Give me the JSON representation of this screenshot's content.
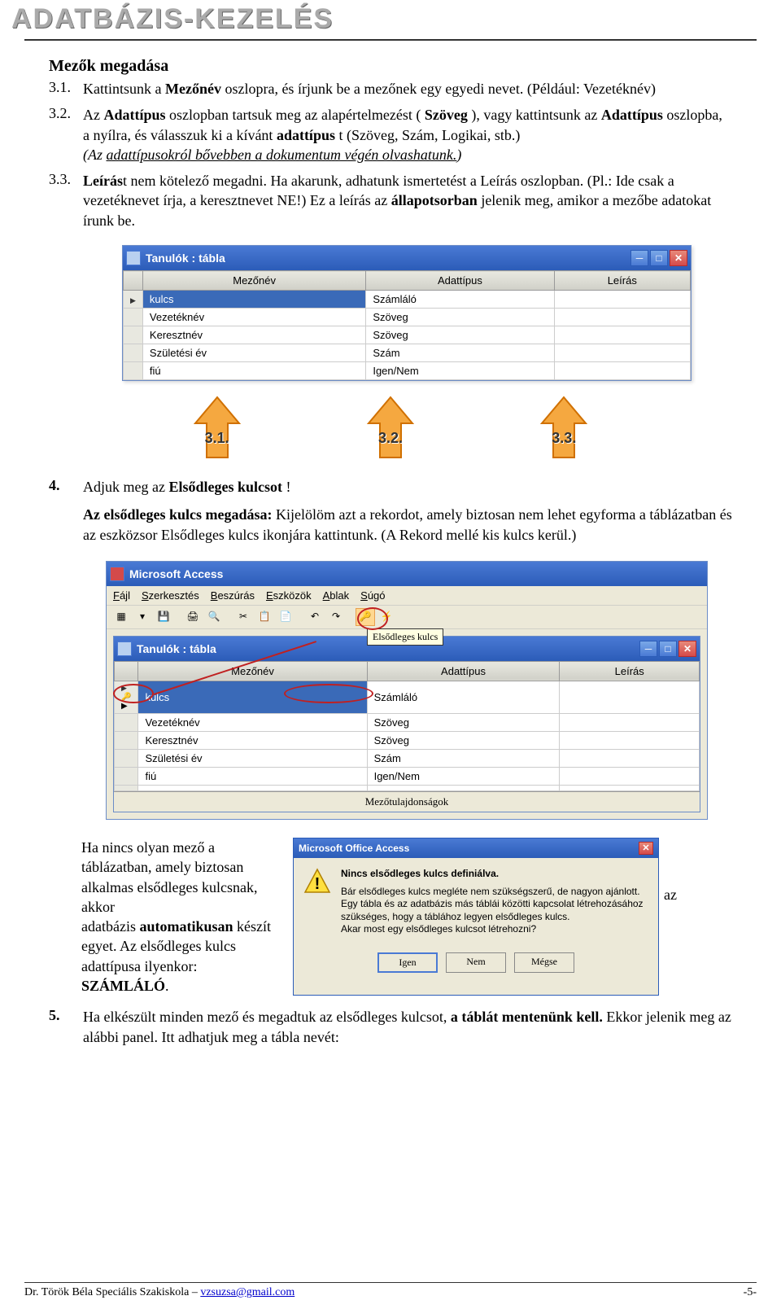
{
  "header": {
    "title": "ADATBÁZIS-KEZELÉS"
  },
  "section_title": "Mezők megadása",
  "items": {
    "i31": {
      "num": "3.1.",
      "text_pre": "Kattintsunk a ",
      "bold1": "Mezőnév",
      "text_mid": " oszlopra, és írjunk be a mezőnek egy egyedi nevet. (Például: Vezetéknév)"
    },
    "i32": {
      "num": "3.2.",
      "text_pre": "Az ",
      "bold1": "Adattípus",
      "text_mid": " oszlopban tartsuk meg az alapértelmezést (",
      "bold2": "Szöveg",
      "text_mid2": "), vagy kattintsunk az ",
      "bold3": "Adattípus",
      "text_mid3": " oszlopba, a nyílra, és válasszuk ki a kívánt ",
      "bold4": "adattípus",
      "text_mid4": "t (Szöveg, Szám, Logikai, stb.)",
      "note_pre": "(Az ",
      "note_ul": "adattípusokról bővebben a dokumentum végén olvashatunk.",
      "note_post": ")"
    },
    "i33": {
      "num": "3.3.",
      "bold1": "Leírás",
      "text": "t nem kötelező megadni. Ha akarunk, adhatunk ismertetést a Leírás oszlopban. (Pl.: Ide csak a vezetéknevet írja, a keresztnevet NE!) Ez a leírás az ",
      "bold2": "állapotsorban",
      "text2": " jelenik meg, amikor a mezőbe adatokat írunk be."
    },
    "i4": {
      "num": "4.",
      "text_pre": "Adjuk meg az ",
      "bold1": "Elsődleges kulcsot",
      "text_post": "!",
      "p2_bold": "Az elsődleges kulcs megadása:",
      "p2": " Kijelölöm azt a rekordot, amely biztosan nem lehet egyforma a táblázatban és az eszközsor Elsődleges kulcs ikonjára kattintunk. (A Rekord mellé kis kulcs kerül.)"
    },
    "i5": {
      "num": "5.",
      "text_pre": "Ha elkészült minden mező és megadtuk az elsődleges kulcsot, ",
      "bold1": "a táblát mentenünk kell.",
      "text_post": " Ekkor jelenik meg az alábbi panel. Itt adhatjuk meg a tábla nevét:"
    }
  },
  "win1": {
    "title": "Tanulók : tábla",
    "headers": [
      "Mezőnév",
      "Adattípus",
      "Leírás"
    ],
    "rows": [
      {
        "name": "kulcs",
        "type": "Számláló",
        "sel": true
      },
      {
        "name": "Vezetéknév",
        "type": "Szöveg"
      },
      {
        "name": "Keresztnév",
        "type": "Szöveg"
      },
      {
        "name": "Születési év",
        "type": "Szám"
      },
      {
        "name": "fiú",
        "type": "Igen/Nem"
      }
    ]
  },
  "arrows": [
    "3.1.",
    "3.2.",
    "3.3."
  ],
  "win2": {
    "app": "Microsoft Access",
    "menu": [
      "Fájl",
      "Szerkesztés",
      "Beszúrás",
      "Eszközök",
      "Ablak",
      "Súgó"
    ],
    "tooltip": "Elsődleges kulcs",
    "inner_title": "Tanulók : tábla",
    "headers": [
      "Mezőnév",
      "Adattípus",
      "Leírás"
    ],
    "rows": [
      {
        "name": "kulcs",
        "type": "Számláló",
        "key": true,
        "sel": true
      },
      {
        "name": "Vezetéknév",
        "type": "Szöveg"
      },
      {
        "name": "Keresztnév",
        "type": "Szöveg"
      },
      {
        "name": "Születési év",
        "type": "Szám"
      },
      {
        "name": "fiú",
        "type": "Igen/Nem"
      }
    ],
    "props": "Mezőtulajdonságok"
  },
  "sidetext": {
    "t1": "Ha nincs olyan mező a táblázatban, amely biztosan alkalmas elsődleges kulcsnak, akkor",
    "t2": "adatbázis ",
    "bold": "automatikusan",
    "t3": " készít egyet. Az elsődleges kulcs adattípusa ilyenkor: ",
    "bold2": "SZÁMLÁLÓ",
    "t4": ".",
    "az": "az"
  },
  "dialog": {
    "title": "Microsoft Office Access",
    "heading": "Nincs elsődleges kulcs definiálva.",
    "body": "Bár elsődleges kulcs megléte nem szükségszerű, de nagyon ajánlott. Egy tábla és az adatbázis más táblái közötti kapcsolat létrehozásához szükséges, hogy a táblához legyen elsődleges kulcs.",
    "question": "Akar most egy elsődleges kulcsot létrehozni?",
    "btns": [
      "Igen",
      "Nem",
      "Mégse"
    ]
  },
  "footer": {
    "school": "Dr. Török Béla Speciális Szakiskola – ",
    "email": "vzsuzsa@gmail.com",
    "page": "-5-"
  }
}
